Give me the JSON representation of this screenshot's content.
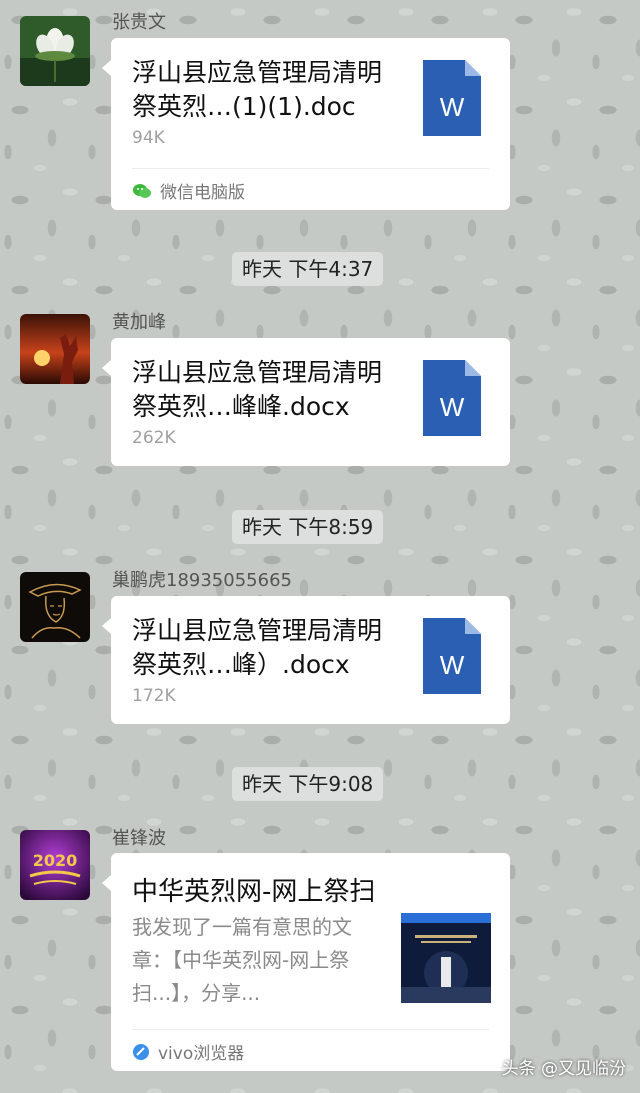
{
  "messages": [
    {
      "sender": "张贵文",
      "file_name": "浮山县应急管理局清明祭英烈…(1)(1).doc",
      "file_size": "94K",
      "file_icon": "word-icon",
      "file_icon_letter": "W",
      "source": "微信电脑版",
      "source_icon": "wechat-icon"
    },
    {
      "timestamp": "昨天 下午4:37",
      "sender": "黄加峰",
      "file_name": "浮山县应急管理局清明祭英烈…峰峰.docx",
      "file_size": "262K",
      "file_icon": "word-icon",
      "file_icon_letter": "W"
    },
    {
      "timestamp": "昨天 下午8:59",
      "sender": "巢鹏虎18935055665",
      "file_name": "浮山县应急管理局清明祭英烈…峰）.docx",
      "file_size": "172K",
      "file_icon": "word-icon",
      "file_icon_letter": "W"
    },
    {
      "timestamp": "昨天 下午9:08",
      "sender": "崔锋波",
      "avatar_text": "2020",
      "link_title": "中华英烈网-网上祭扫",
      "link_desc": "我发现了一篇有意思的文章：【中华英烈网-网上祭扫...】，分享...",
      "source": "vivo浏览器",
      "source_icon": "vivo-browser-icon"
    }
  ],
  "watermark": "头条 @又见临汾",
  "colors": {
    "wallpaper": "#c4c9c6",
    "bubble": "#ffffff",
    "word_blue": "#2b5fb4",
    "timestamp_chip": "#dcdfdd",
    "secondary_text": "#a0a0a0"
  }
}
